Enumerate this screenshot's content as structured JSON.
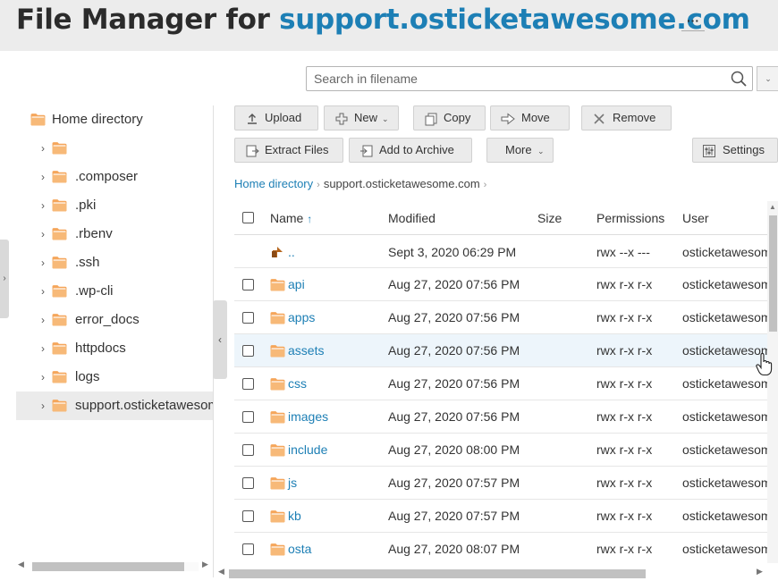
{
  "header": {
    "title_prefix": "File Manager for ",
    "title_domain": "support.osticketawesome.com",
    "more_label": "···"
  },
  "search": {
    "placeholder": "Search in filename",
    "dropdown_label": "⌄"
  },
  "tree": {
    "root_label": "Home directory",
    "items": [
      {
        "label": ""
      },
      {
        "label": ".composer"
      },
      {
        "label": ".pki"
      },
      {
        "label": ".rbenv"
      },
      {
        "label": ".ssh"
      },
      {
        "label": ".wp-cli"
      },
      {
        "label": "error_docs"
      },
      {
        "label": "httpdocs"
      },
      {
        "label": "logs"
      },
      {
        "label": "support.osticketawesome.com"
      }
    ],
    "selected_index": 9
  },
  "toolbar": {
    "upload": "Upload",
    "new": "New",
    "copy": "Copy",
    "move": "Move",
    "remove": "Remove",
    "extract": "Extract Files",
    "archive": "Add to Archive",
    "more": "More",
    "settings": "Settings"
  },
  "breadcrumb": {
    "home": "Home directory",
    "current": "support.osticketawesome.com"
  },
  "table": {
    "columns": {
      "name": "Name",
      "sort_indicator": "↑",
      "modified": "Modified",
      "size": "Size",
      "permissions": "Permissions",
      "user": "User"
    },
    "parent_row": {
      "name": "..",
      "modified": "Sept 3, 2020 06:29 PM",
      "permissions": "rwx --x ---",
      "user": "osticketawesome"
    },
    "rows": [
      {
        "name": "api",
        "modified": "Aug 27, 2020 07:56 PM",
        "permissions": "rwx r-x r-x",
        "user": "osticketawesome"
      },
      {
        "name": "apps",
        "modified": "Aug 27, 2020 07:56 PM",
        "permissions": "rwx r-x r-x",
        "user": "osticketawesome"
      },
      {
        "name": "assets",
        "modified": "Aug 27, 2020 07:56 PM",
        "permissions": "rwx r-x r-x",
        "user": "osticketawesome"
      },
      {
        "name": "css",
        "modified": "Aug 27, 2020 07:56 PM",
        "permissions": "rwx r-x r-x",
        "user": "osticketawesome"
      },
      {
        "name": "images",
        "modified": "Aug 27, 2020 07:56 PM",
        "permissions": "rwx r-x r-x",
        "user": "osticketawesome"
      },
      {
        "name": "include",
        "modified": "Aug 27, 2020 08:00 PM",
        "permissions": "rwx r-x r-x",
        "user": "osticketawesome"
      },
      {
        "name": "js",
        "modified": "Aug 27, 2020 07:57 PM",
        "permissions": "rwx r-x r-x",
        "user": "osticketawesome"
      },
      {
        "name": "kb",
        "modified": "Aug 27, 2020 07:57 PM",
        "permissions": "rwx r-x r-x",
        "user": "osticketawesome"
      },
      {
        "name": "osta",
        "modified": "Aug 27, 2020 08:07 PM",
        "permissions": "rwx r-x r-x",
        "user": "osticketawesome"
      }
    ],
    "hovered_index": 2
  },
  "colors": {
    "accent": "#1d7fb5",
    "folder": "#f5a65b",
    "hover_row": "#edf5fb"
  }
}
